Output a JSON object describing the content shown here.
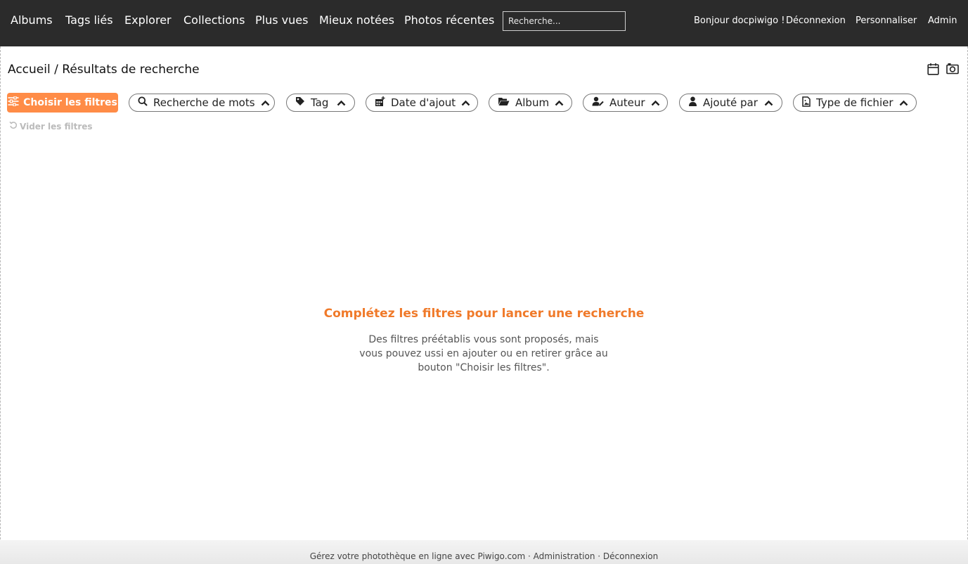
{
  "nav": {
    "items": [
      "Albums",
      "Tags liés",
      "Explorer",
      "Collections",
      "Plus vues",
      "Mieux notées",
      "Photos récentes"
    ],
    "search_placeholder": "Recherche...",
    "greeting": "Bonjour docpiwigo !",
    "logout": "Déconnexion",
    "customize": "Personnaliser",
    "admin": "Admin"
  },
  "breadcrumb": {
    "home": "Accueil",
    "separator": "/",
    "current": "Résultats de recherche"
  },
  "filters": {
    "choose_label": "Choisir les filtres",
    "items": [
      "Recherche de mots",
      "Tag",
      "Date d'ajout",
      "Album",
      "Auteur",
      "Ajouté par",
      "Type de fichier"
    ],
    "reset_label": "Vider les filtres"
  },
  "empty_state": {
    "title": "Complétez les filtres pour lancer une recherche",
    "line1": "Des filtres préétablis vous sont proposés, mais",
    "line2": "vous pouvez ussi en ajouter ou en retirer grâce au",
    "line3": "bouton \"Choisir les filtres\"."
  },
  "footer": {
    "text": "Gérez votre photothèque en ligne avec",
    "piwigo_link": "Piwigo.com",
    "sep": "·",
    "admin_link": "Administration",
    "logout_link": "Déconnexion"
  },
  "colors": {
    "accent": "#ff8c47",
    "accent_text": "#f07a2a",
    "nav_bg": "#2b2b2b"
  },
  "icons": [
    "filter-sliders-icon",
    "search-icon",
    "tag-icon",
    "calendar-plus-icon",
    "folder-open-icon",
    "user-edit-icon",
    "user-icon",
    "file-image-icon",
    "chevron-up-icon",
    "undo-icon",
    "calendar-icon",
    "camera-icon"
  ]
}
